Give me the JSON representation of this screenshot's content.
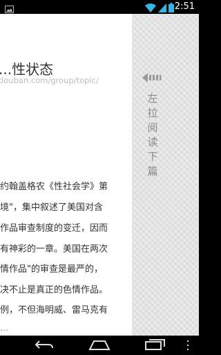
{
  "status_bar": {
    "time": "2:51",
    "icons": [
      "image-notification-icon",
      "wifi-icon",
      "cell-signal-icon",
      "battery-icon"
    ]
  },
  "article": {
    "title": "...性状态",
    "source": "douban.com/group/topic/",
    "lines": [
      "约翰盖格农《性社会学》第",
      "境\"，集中叙述了美国对含",
      "作品审查制度的变迁，因而",
      "有神彩的一章。美国在两次",
      "情作品\"的审查是最严的，",
      "决不止是真正的色情作品。",
      "例，不但海明威、雷马克有",
      "..."
    ]
  },
  "side_panel": {
    "label": [
      "左",
      "拉",
      "阅",
      "读",
      "下",
      "篇"
    ]
  },
  "nav_bar": {
    "buttons": [
      "back-icon",
      "home-icon",
      "recent-apps-icon",
      "menu-icon"
    ]
  }
}
